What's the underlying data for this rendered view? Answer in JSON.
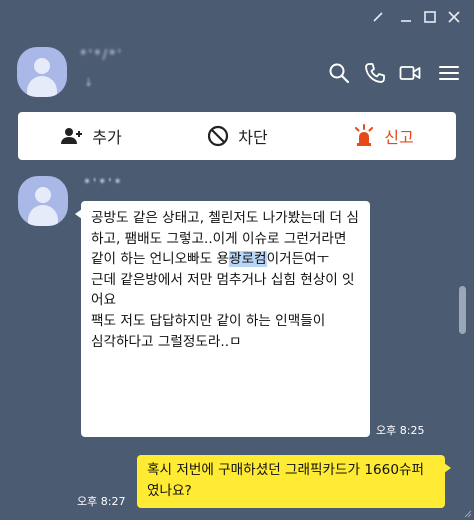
{
  "window": {
    "buttons": [
      "pin-icon",
      "minimize-icon",
      "maximize-icon",
      "close-icon"
    ]
  },
  "header": {
    "chat_name": "*'*/*'",
    "member_count": "↓",
    "icons": [
      "search-icon",
      "call-icon",
      "video-icon",
      "menu-icon"
    ]
  },
  "actions": {
    "add_label": "추가",
    "block_label": "차단",
    "report_label": "신고",
    "report_color": "#e64a19"
  },
  "messages": {
    "incoming": {
      "sender": "*'*'*",
      "text_before": "공방도 같은 상태고, 첼린저도 나가봤는데 더 심하고, 팸배도 그렇고..이게 이슈로 그런거라면\n같이 하는 언니오빠도 용",
      "text_highlight": "광로컴",
      "text_after": "이거든여ㅜ\n근데 같은방에서 저만 멈추거나 십힘 현상이 잇어요\n팩도 저도 답답하지만 같이 하는 인맥들이\n심각하다고 그럴정도라..ㅁ",
      "time": "오후 8:25"
    },
    "outgoing": {
      "text": "혹시 저번에 구매하셨던 그래픽카드가 1660슈퍼였나요?",
      "time": "오후 8:27",
      "bubble_color": "#ffeb33"
    }
  },
  "colors": {
    "background": "#4b5b72",
    "highlight": "#b9d6f7"
  }
}
